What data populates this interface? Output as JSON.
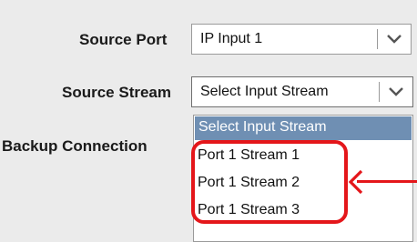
{
  "form": {
    "source_port": {
      "label": "Source Port",
      "value": "IP Input 1"
    },
    "source_stream": {
      "label": "Source Stream",
      "value": "Select Input Stream"
    },
    "backup_connection": {
      "label": "Backup Connection"
    }
  },
  "dropdown": {
    "options": [
      "Select Input Stream",
      "Port 1 Stream 1",
      "Port 1 Stream 2",
      "Port 1 Stream 3"
    ]
  },
  "colors": {
    "highlight": "#e4161a",
    "selected_option": "#6f8fb3"
  },
  "icons": {
    "select_arrow": "chevron-down-icon",
    "annotation": "arrow-left-icon"
  }
}
